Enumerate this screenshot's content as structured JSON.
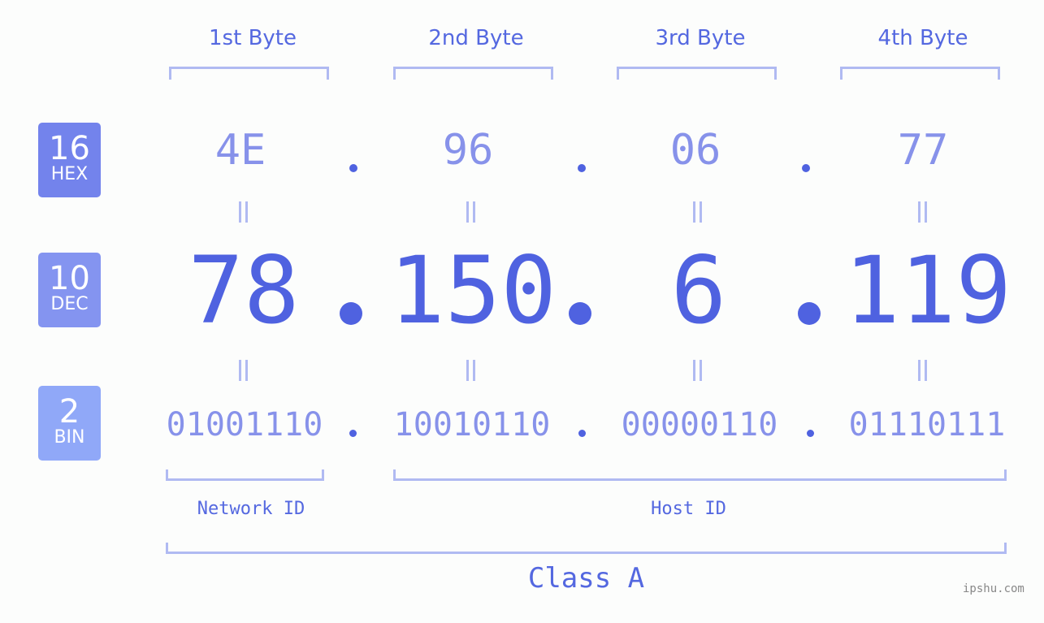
{
  "badges": {
    "hex": {
      "num": "16",
      "label": "HEX",
      "color": "#7383ec"
    },
    "dec": {
      "num": "10",
      "label": "DEC",
      "color": "#8494f0"
    },
    "bin": {
      "num": "2",
      "label": "BIN",
      "color": "#90a8f8"
    }
  },
  "bytes": [
    {
      "header": "1st Byte",
      "hex": "4E",
      "dec": "78",
      "bin": "01001110"
    },
    {
      "header": "2nd Byte",
      "hex": "96",
      "dec": "150",
      "bin": "10010110"
    },
    {
      "header": "3rd Byte",
      "hex": "06",
      "dec": "6",
      "bin": "00000110"
    },
    {
      "header": "4th Byte",
      "hex": "77",
      "dec": "119",
      "bin": "01110111"
    }
  ],
  "network_id_label": "Network ID",
  "host_id_label": "Host ID",
  "class_label": "Class A",
  "watermark": "ipshu.com"
}
